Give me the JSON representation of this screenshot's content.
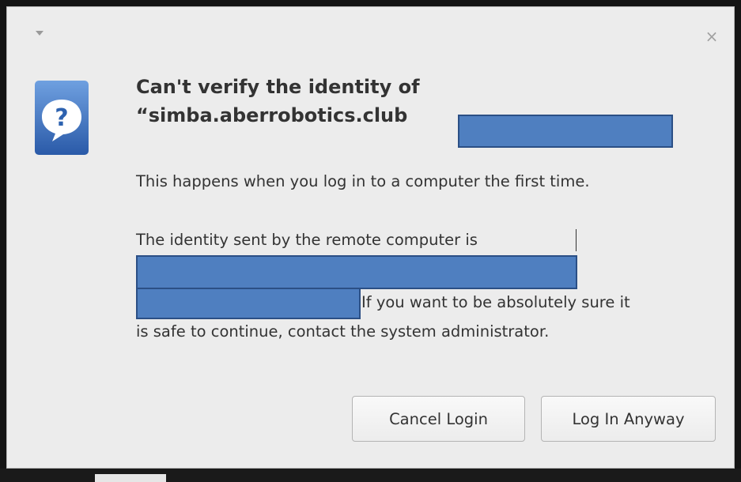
{
  "dialog": {
    "heading_line1": "Can't verify the identity of",
    "heading_line2": "“simba.aberrobotics.club",
    "message_line1": "This happens when you log in to a computer the first time.",
    "message_line2": "The identity sent by the remote computer is",
    "message_line3": "If you want to be absolutely sure it",
    "message_line4": "is safe to continue, contact the system administrator.",
    "icon": "question-icon",
    "redaction_color": "#4f7fc0"
  },
  "titlebar": {
    "menu_icon": "chevron-down-icon",
    "close_glyph": "×"
  },
  "buttons": {
    "cancel_label": "Cancel Login",
    "login_label": "Log In Anyway"
  }
}
